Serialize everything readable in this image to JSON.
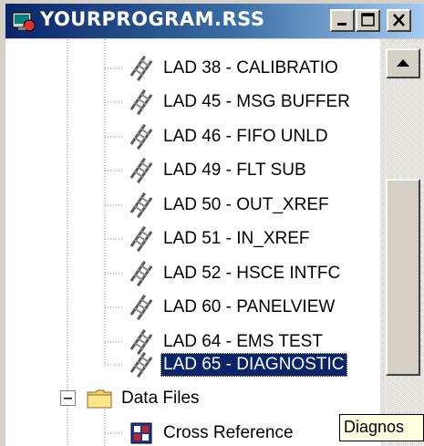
{
  "window": {
    "title": "YOURPROGRAM.RSS",
    "minimize_label": "minimize",
    "maximize_label": "maximize",
    "close_label": "close"
  },
  "tree": {
    "ladder_items": [
      {
        "label": "LAD 38 - CALIBRATIO",
        "icon": "ladder-icon"
      },
      {
        "label": "LAD 45 - MSG BUFFER",
        "icon": "ladder-icon"
      },
      {
        "label": "LAD 46 - FIFO UNLD",
        "icon": "ladder-icon"
      },
      {
        "label": "LAD 49 - FLT SUB",
        "icon": "ladder-icon"
      },
      {
        "label": "LAD 50 - OUT_XREF",
        "icon": "ladder-icon"
      },
      {
        "label": "LAD 51 - IN_XREF",
        "icon": "ladder-icon"
      },
      {
        "label": "LAD 52 - HSCE INTFC",
        "icon": "ladder-icon"
      },
      {
        "label": "LAD 60 - PANELVIEW",
        "icon": "ladder-icon"
      },
      {
        "label": "LAD 64 - EMS TEST",
        "icon": "ladder-icon"
      },
      {
        "label": "LAD 65 - DIAGNOSTIC",
        "icon": "ladder-icon",
        "selected": true
      }
    ],
    "data_files": {
      "label": "Data Files",
      "icon": "folder-icon",
      "expander": "minus"
    },
    "cross_reference": {
      "label": "Cross Reference",
      "icon": "cross-reference-icon"
    }
  },
  "tooltip": {
    "text": "Diagnos"
  },
  "colors": {
    "title_gradient_start": "#0a246a",
    "title_gradient_end": "#a6caf0",
    "selection": "#0a246a",
    "tooltip_bg": "#ffffe1",
    "chrome": "#d4d0c8"
  }
}
